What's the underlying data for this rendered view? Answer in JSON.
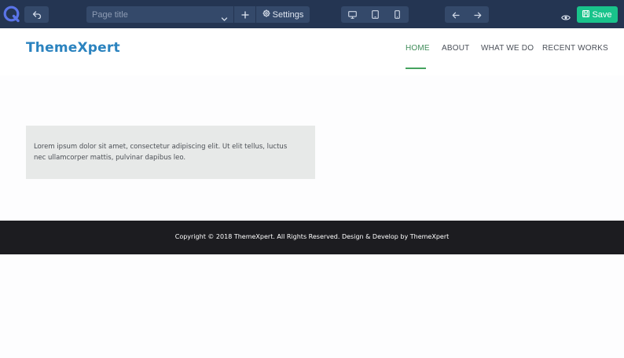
{
  "toolbar": {
    "page_title_placeholder": "Page title",
    "settings_label": "Settings",
    "save_label": "Save"
  },
  "site": {
    "brand": "ThemeXpert",
    "nav": [
      {
        "label": "HOME",
        "active": true
      },
      {
        "label": "ABOUT",
        "active": false
      },
      {
        "label": "WHAT WE DO",
        "active": false
      },
      {
        "label": "RECENT WORKS",
        "active": false
      }
    ],
    "content_text": "Lorem ipsum dolor sit amet, consectetur adipiscing elit. Ut elit tellus, luctus nec ullamcorper mattis, pulvinar dapibus leo.",
    "footer_text": "Copyright © 2018 ThemeXpert. All Rights Reserved. Design & Develop by ThemeXpert"
  },
  "icons": {
    "logo": "quix-logo-icon",
    "undo": "undo-icon",
    "chevron": "chevron-down-icon",
    "add": "plus-icon",
    "settings": "gear-icon",
    "desktop": "desktop-icon",
    "tablet": "tablet-icon",
    "mobile": "mobile-icon",
    "back": "arrow-left-icon",
    "forward": "arrow-right-icon",
    "preview": "eye-icon",
    "save": "save-icon"
  },
  "colors": {
    "toolbar_bg": "#243552",
    "toolbar_button": "#34496a",
    "save_button": "#19c38b",
    "brand": "#2b83bf",
    "nav_active": "#45a35f",
    "content_box": "#e7e9e8",
    "footer_bg": "#1c1c20"
  }
}
